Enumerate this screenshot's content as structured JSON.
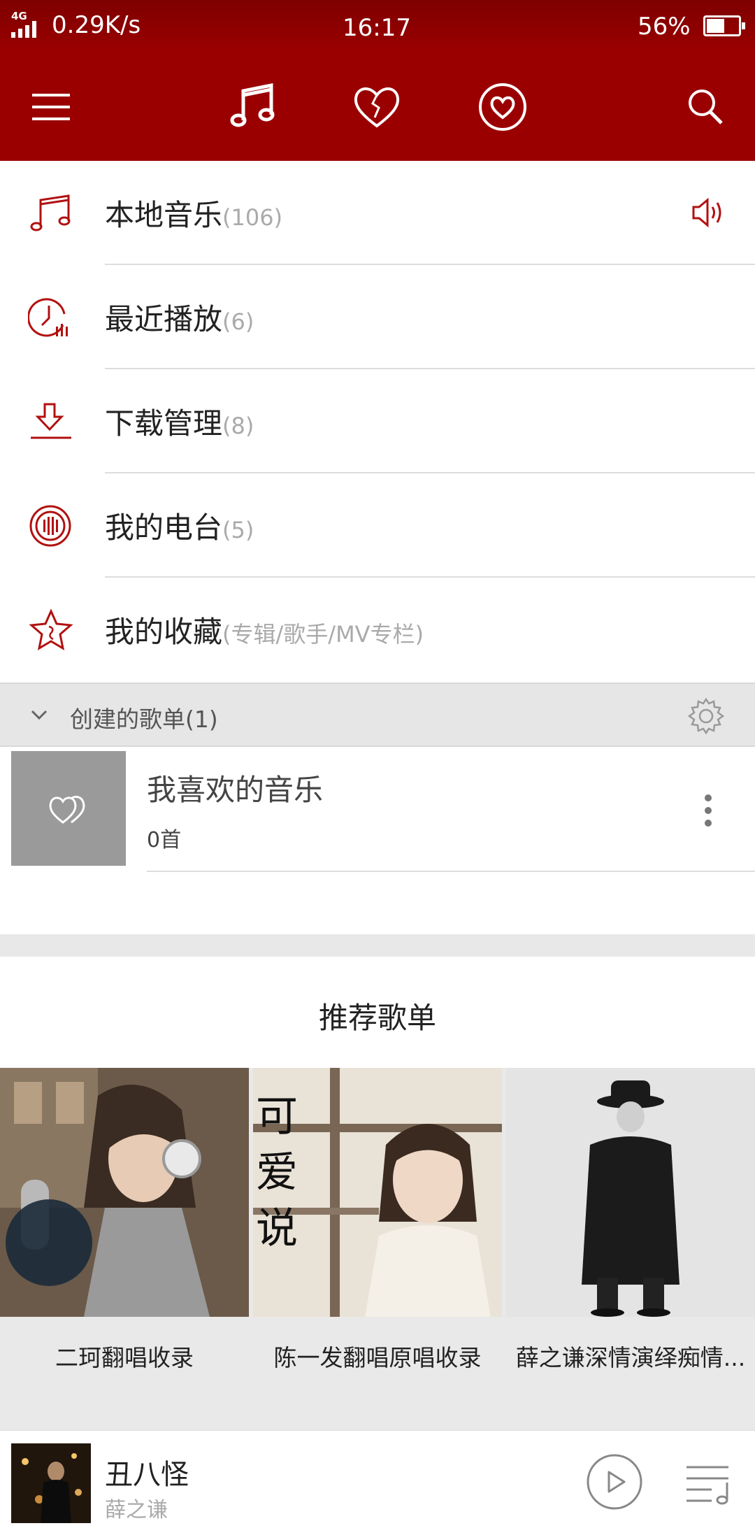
{
  "status_bar": {
    "network": "4G",
    "speed": "0.29K/s",
    "time": "16:17",
    "battery_text": "56%",
    "battery_level": 0.56
  },
  "top_nav": {
    "icons": [
      "menu-icon",
      "music-note-icon",
      "heart-broken-icon",
      "heart-circle-icon",
      "search-icon"
    ],
    "accent_color": "#9b0000"
  },
  "menu": {
    "items": [
      {
        "icon": "music-note-icon",
        "label": "本地音乐",
        "count": "(106)"
      },
      {
        "icon": "recent-clock-icon",
        "label": "最近播放",
        "count": "(6)"
      },
      {
        "icon": "download-icon",
        "label": "下载管理",
        "count": "(8)"
      },
      {
        "icon": "radio-icon",
        "label": "我的电台",
        "count": "(5)"
      },
      {
        "icon": "star-icon",
        "label": "我的收藏",
        "count": "(专辑/歌手/MV专栏)"
      }
    ]
  },
  "created_playlists": {
    "header": "创建的歌单(1)",
    "items": [
      {
        "name": "我喜欢的音乐",
        "count": "0首"
      }
    ]
  },
  "recommended": {
    "title": "推荐歌单",
    "items": [
      {
        "caption": "二珂翻唱收录"
      },
      {
        "caption": "陈一发翻唱原唱收录"
      },
      {
        "caption": "薛之谦深情演绎痴情..."
      }
    ]
  },
  "now_playing": {
    "song": "丑八怪",
    "artist": "薛之谦"
  }
}
